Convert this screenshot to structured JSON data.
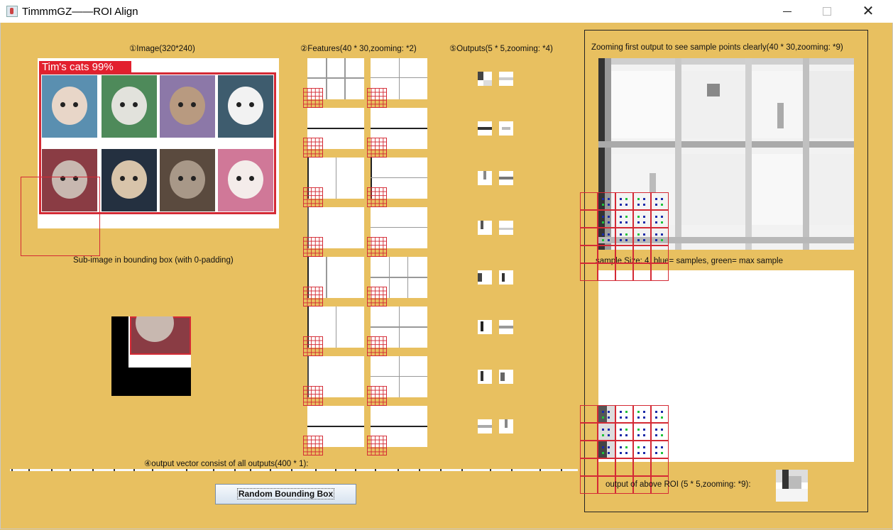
{
  "window": {
    "title": "TimmmGZ——ROI Align",
    "minimize_symbol": "",
    "maximize_symbol": "",
    "close_symbol": "✕"
  },
  "sections": {
    "image": {
      "label": "①Image(320*240)",
      "detection_tag": "Tim's cats 99%",
      "subimage_label": "Sub-image in bounding box (with 0-padding)"
    },
    "features": {
      "label": "②Features(40 * 30,zooming: *2)"
    },
    "outputs": {
      "label": "⑤Outputs(5 * 5,zooming: *4)"
    },
    "zoom": {
      "label": "Zooming first output to see sample points clearly(40 * 30,zooming: *9)",
      "sample_label": "sample Size: 4, blue= samples, green= max sample",
      "roi_output_label": "output of above ROI (5 * 5,zooming: *9):"
    },
    "vector": {
      "label": "④output vector consist of all outputs(400 * 1):"
    }
  },
  "button": {
    "random_label": "Random Bounding Box"
  },
  "colors": {
    "background": "#e8c060",
    "roi_red": "#d42a35",
    "sample_blue": "#1a2aa8",
    "sample_green": "#1fc23a",
    "button_border": "#7a8ea6"
  },
  "icons": [
    "app-java-icon",
    "minimize-icon",
    "maximize-icon",
    "close-icon"
  ]
}
